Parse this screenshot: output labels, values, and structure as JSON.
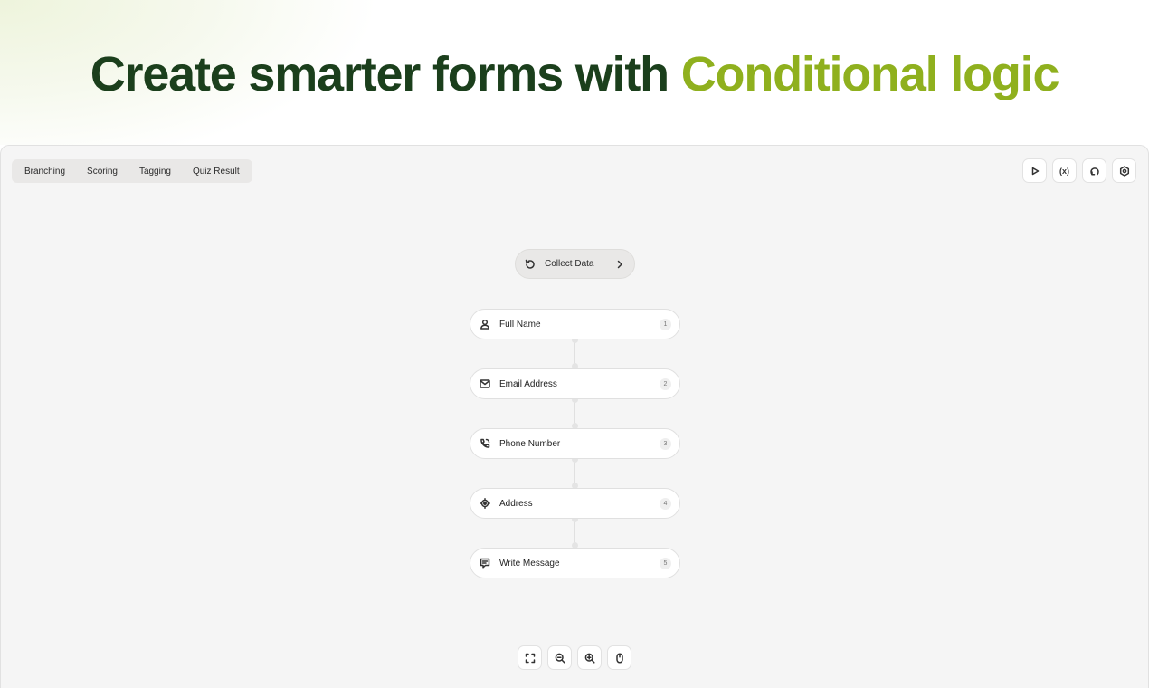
{
  "hero": {
    "title_main": "Create smarter forms with ",
    "title_accent": "Conditional logic"
  },
  "tabs": [
    {
      "label": "Branching"
    },
    {
      "label": "Scoring"
    },
    {
      "label": "Tagging"
    },
    {
      "label": "Quiz Result"
    }
  ],
  "toolbar": {
    "play_icon": "play-icon",
    "variables_label": "(x)",
    "undo_icon": "undo-icon",
    "settings_icon": "settings-icon"
  },
  "collect": {
    "label": "Collect Data",
    "icon": "refresh-icon",
    "arrow_icon": "chevron-right-icon"
  },
  "fields": [
    {
      "label": "Full Name",
      "num": "1",
      "icon": "user-icon"
    },
    {
      "label": "Email Address",
      "num": "2",
      "icon": "mail-icon"
    },
    {
      "label": "Phone Number",
      "num": "3",
      "icon": "phone-icon"
    },
    {
      "label": "Address",
      "num": "4",
      "icon": "location-icon"
    },
    {
      "label": "Write Message",
      "num": "5",
      "icon": "message-icon"
    }
  ],
  "zoom_controls": [
    "fit-view-icon",
    "zoom-out-icon",
    "zoom-in-icon",
    "mouse-icon"
  ],
  "colors": {
    "title": "#1b3f1c",
    "accent": "#8fb01e"
  }
}
